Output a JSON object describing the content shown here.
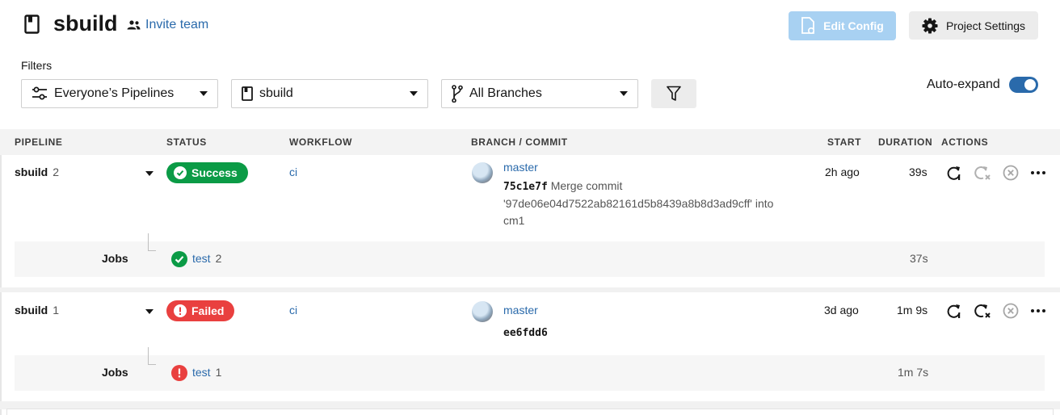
{
  "header": {
    "project_name": "sbuild",
    "invite_label": "Invite team",
    "edit_config_label": "Edit Config",
    "project_settings_label": "Project Settings"
  },
  "filters": {
    "label": "Filters",
    "pipelines_select": "Everyone’s Pipelines",
    "project_select": "sbuild",
    "branch_select": "All Branches",
    "auto_expand_label": "Auto-expand",
    "auto_expand_on": true
  },
  "table": {
    "columns": [
      "PIPELINE",
      "STATUS",
      "WORKFLOW",
      "BRANCH / COMMIT",
      "START",
      "DURATION",
      "ACTIONS"
    ],
    "rows": [
      {
        "pipeline": "sbuild",
        "number": "2",
        "status": "Success",
        "workflow": "ci",
        "branch": "master",
        "commit_hash": "75c1e7f",
        "commit_msg_1": "Merge commit",
        "commit_msg_2": "'97de06e04d7522ab82161d5b8439a8b8d3ad9cff' into",
        "commit_msg_3": "cm1",
        "start": "2h ago",
        "duration": "39s",
        "jobs_label": "Jobs",
        "job_name": "test",
        "job_number": "2",
        "job_duration": "37s"
      },
      {
        "pipeline": "sbuild",
        "number": "1",
        "status": "Failed",
        "workflow": "ci",
        "branch": "master",
        "commit_hash": "ee6fdd6",
        "start": "3d ago",
        "duration": "1m 9s",
        "jobs_label": "Jobs",
        "job_name": "test",
        "job_number": "1",
        "job_duration": "1m 7s"
      }
    ]
  },
  "colors": {
    "accent": "#2a6aab",
    "success": "#0b9b46",
    "failed": "#e9403f",
    "edit_config_disabled": "#a8d1f2"
  }
}
